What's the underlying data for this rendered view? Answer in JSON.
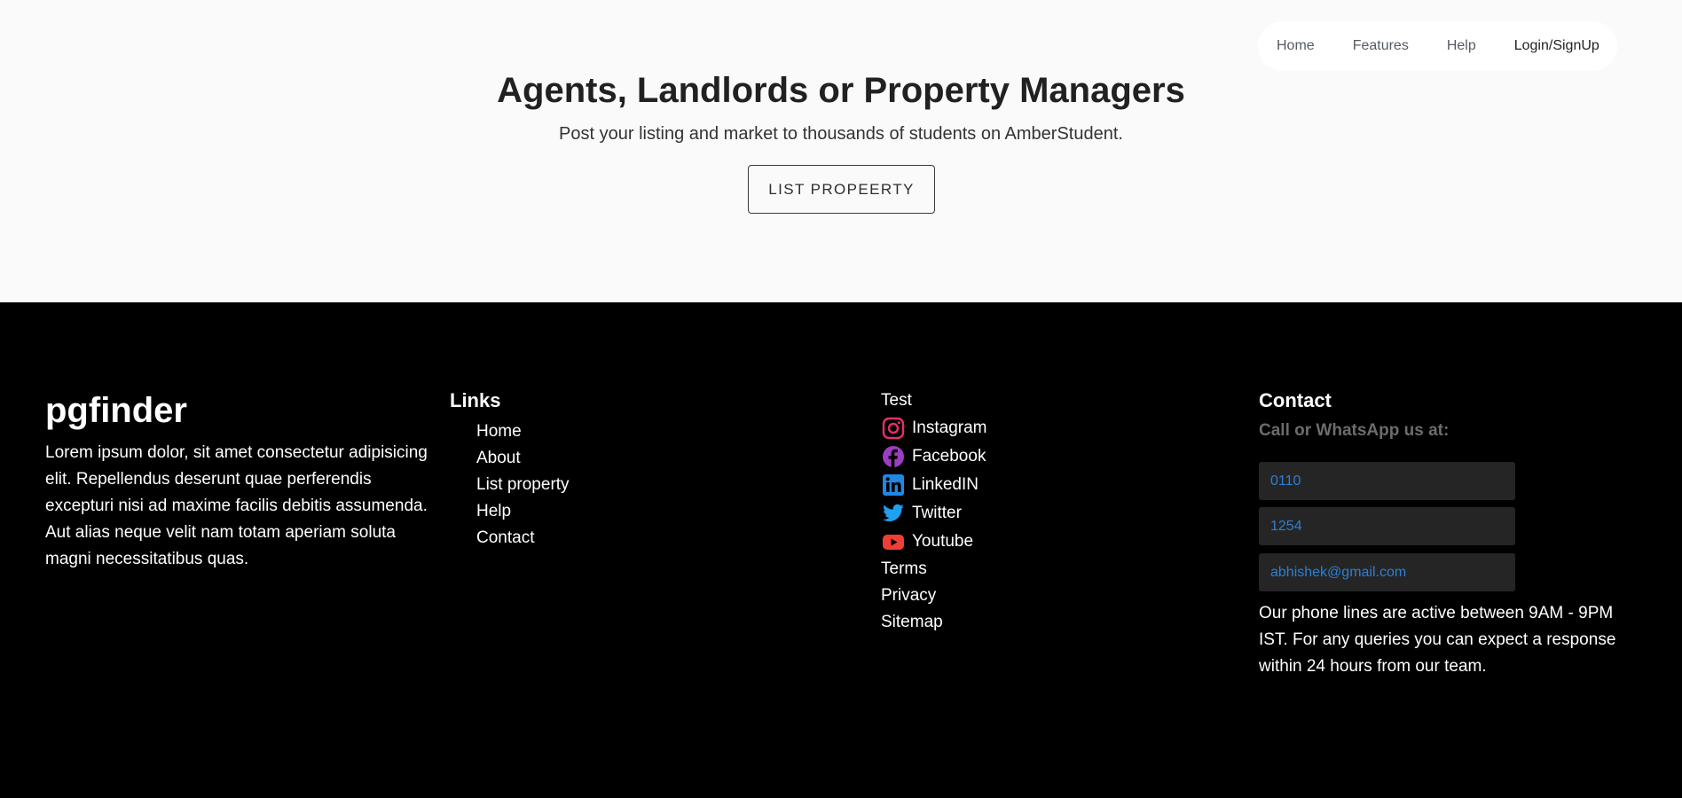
{
  "nav": {
    "items": [
      "Home",
      "Features",
      "Help",
      "Login/SignUp"
    ]
  },
  "hero": {
    "title": "Agents, Landlords or Property Managers",
    "subtitle": "Post your listing and market to thousands of students on AmberStudent.",
    "button_label": "LIST PROPEERTY"
  },
  "footer": {
    "brand": "pgfinder",
    "description": "Lorem ipsum dolor, sit amet consectetur adipisicing elit. Repellendus deserunt quae perferendis excepturi nisi ad maxime facilis debitis assumenda. Aut alias neque velit nam totam aperiam soluta magni necessitatibus quas.",
    "links": {
      "title": "Links",
      "items": [
        "Home",
        "About",
        "List property",
        "Help",
        "Contact"
      ]
    },
    "social": {
      "heading": "Test",
      "items": [
        {
          "label": "Instagram",
          "icon": "instagram-icon",
          "color": "#e1306c"
        },
        {
          "label": "Facebook",
          "icon": "facebook-icon",
          "color": "#9b3ec0"
        },
        {
          "label": "LinkedIN",
          "icon": "linkedin-icon",
          "color": "#1e88e5"
        },
        {
          "label": "Twitter",
          "icon": "twitter-icon",
          "color": "#1da1f2"
        },
        {
          "label": "Youtube",
          "icon": "youtube-icon",
          "color": "#ef3e36"
        }
      ],
      "extra": [
        "Terms",
        "Privacy",
        "Sitemap"
      ]
    },
    "contact": {
      "title": "Contact",
      "subtitle": "Call or WhatsApp us at:",
      "fields": [
        "0110",
        "1254",
        "abhishek@gmail.com"
      ],
      "note": "Our phone lines are active between 9AM - 9PM IST. For any queries you can expect a response within 24 hours from our team."
    }
  },
  "colors": {
    "top_bg": "#fafafa",
    "footer_bg": "#000000",
    "field_bg": "#252525",
    "field_text": "#2f7fd3",
    "muted": "#6c6c6c"
  }
}
